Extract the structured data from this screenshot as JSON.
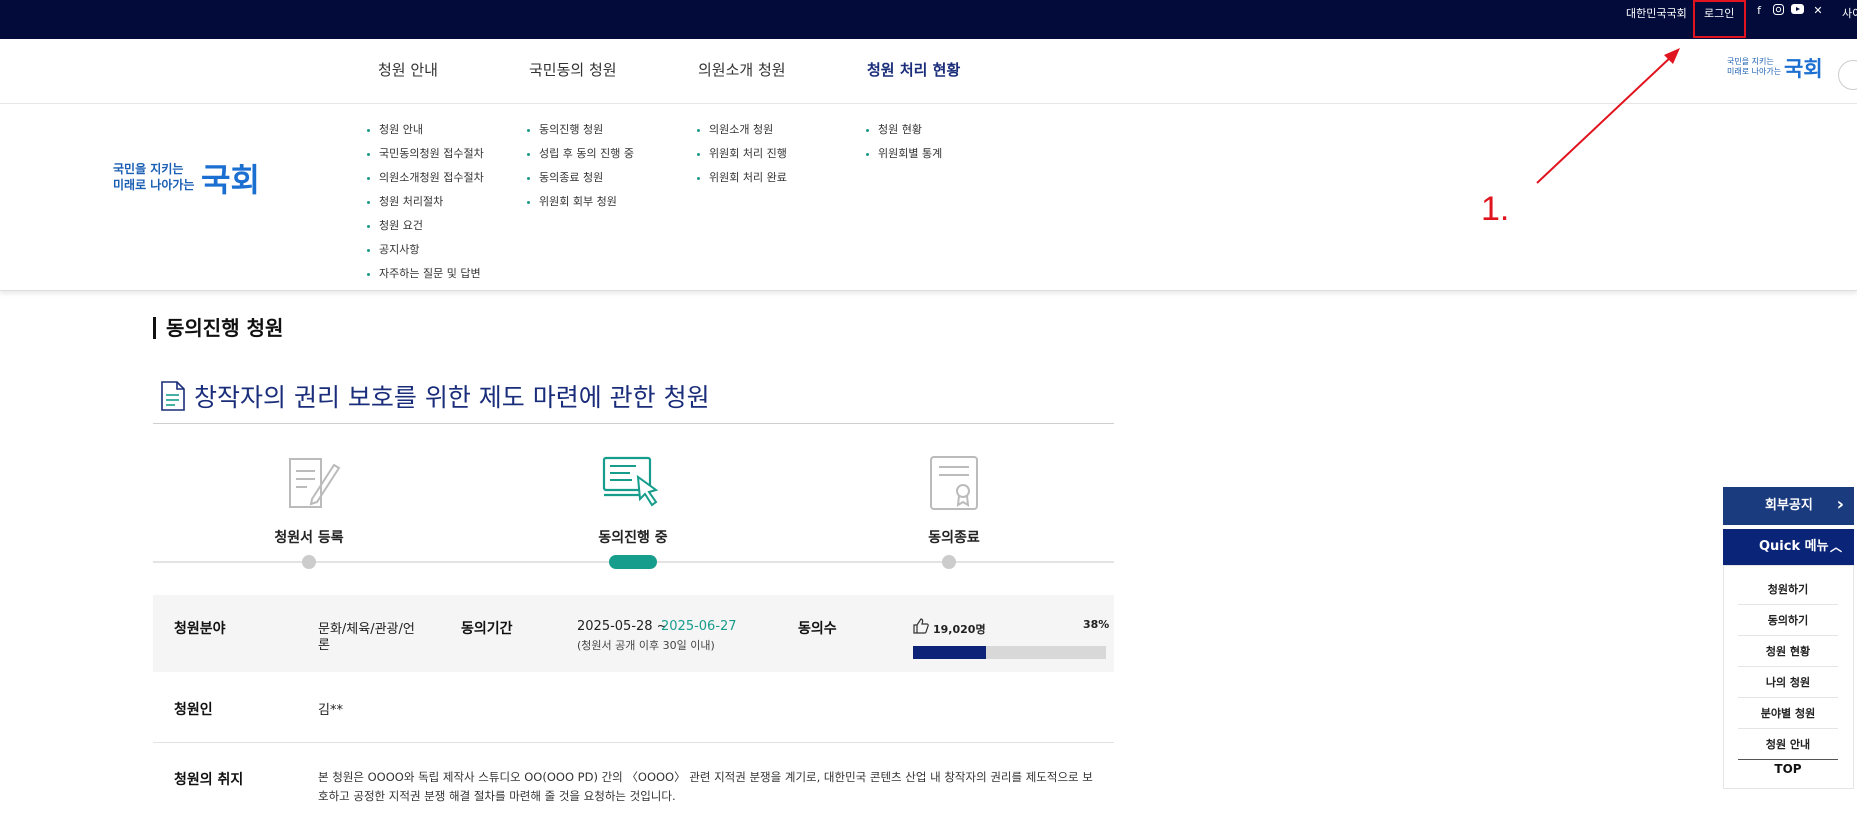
{
  "topbar": {
    "assembly_link": "대한민국국회",
    "login_link": "로그인",
    "sitemap_link": "사이",
    "sns": [
      "facebook-icon",
      "instagram-icon",
      "youtube-icon",
      "x-icon"
    ]
  },
  "logo": {
    "line1": "국민을 지키는",
    "line2": "미래로 나아가는",
    "word": "국회"
  },
  "gnb": {
    "menus": [
      "청원 안내",
      "국민동의 청원",
      "의원소개 청원",
      "청원 처리 현황"
    ]
  },
  "mega": {
    "col1": [
      "청원 안내",
      "국민동의청원 접수절차",
      "의원소개청원 접수절차",
      "청원 처리절차",
      "청원 요건",
      "공지사항",
      "자주하는 질문 및 답변"
    ],
    "col2": [
      "동의진행 청원",
      "성립 후 동의 진행 중",
      "동의종료 청원",
      "위원회 회부 청원"
    ],
    "col3": [
      "의원소개 청원",
      "위원회 처리 진행",
      "위원회 처리 완료"
    ],
    "col4": [
      "청원 현황",
      "위원회별 통계"
    ]
  },
  "annotation": {
    "label": "1.",
    "color": "#e0141e"
  },
  "section": {
    "title": "동의진행 청원"
  },
  "petition": {
    "title": "창작자의 권리 보호를 위한 제도 마련에 관한 청원",
    "steps": [
      "청원서 등록",
      "동의진행 중",
      "동의종료"
    ],
    "active_step": 1,
    "field_label": "청원분야",
    "field_value_1": "문화/체육/관광/언",
    "field_value_2": "론",
    "period_label": "동의기간",
    "period_start": "2025-05-28 ~",
    "period_end": "2025-06-27",
    "period_note": "(청원서 공개 이후 30일 이내)",
    "count_label": "동의수",
    "count_value": "19,020명",
    "percent": "38%",
    "progress": 0.38,
    "petitioner_label": "청원인",
    "petitioner_value": "김**",
    "purpose_label": "청원의 취지",
    "purpose_line1": "본 청원은 OOOO와 독립 제작사 스튜디오 OO(OOO PD) 간의 〈OOOO〉 관련 지적권 분쟁을 계기로, 대한민국 콘텐츠 산업 내 창작자의 권리를 제도적으로 보",
    "purpose_line2": "호하고 공정한 지적권 분쟁 해결 절차를 마련해 줄 것을 요청하는 것입니다."
  },
  "quick": {
    "notice": "회부공지",
    "head": "Quick 메뉴",
    "items": [
      "청원하기",
      "동의하기",
      "청원 현황",
      "나의 청원",
      "분야별 청원",
      "청원 안내"
    ],
    "top": "TOP"
  },
  "colors": {
    "topbar": "#020b3a",
    "accent_navy": "#1a2d7a",
    "teal": "#179d8c",
    "annotation_red": "#e0141e"
  }
}
